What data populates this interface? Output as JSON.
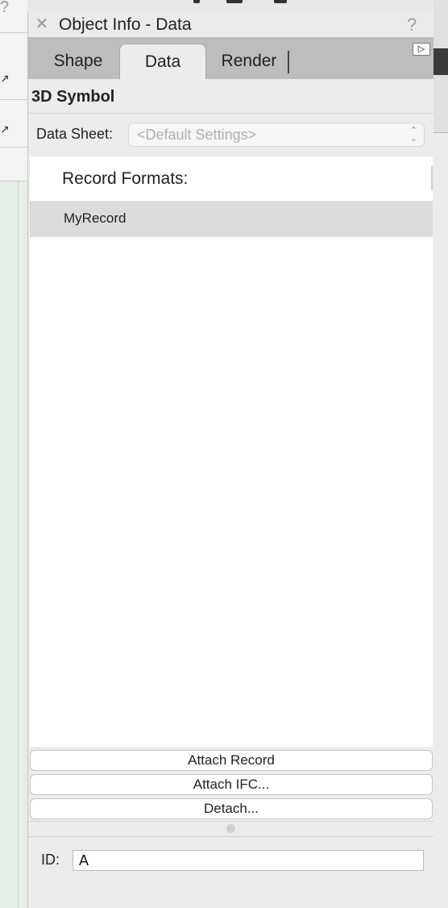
{
  "palette": {
    "title": "Object Info - Data",
    "close_glyph": "✕",
    "help_glyph": "?",
    "expand_glyph": "▷"
  },
  "tabs": [
    {
      "label": "Shape",
      "selected": false
    },
    {
      "label": "Data",
      "selected": true
    },
    {
      "label": "Render",
      "selected": false
    }
  ],
  "object_type": "3D Symbol",
  "data_sheet": {
    "label": "Data Sheet:",
    "value": "<Default Settings>"
  },
  "records": {
    "header": "Record Formats:",
    "items": [
      "MyRecord"
    ]
  },
  "buttons": {
    "attach_record": "Attach Record",
    "attach_ifc": "Attach IFC...",
    "detach": "Detach..."
  },
  "id_field": {
    "label": "ID:",
    "value": "A"
  },
  "background": {
    "help_glyph": "?"
  }
}
